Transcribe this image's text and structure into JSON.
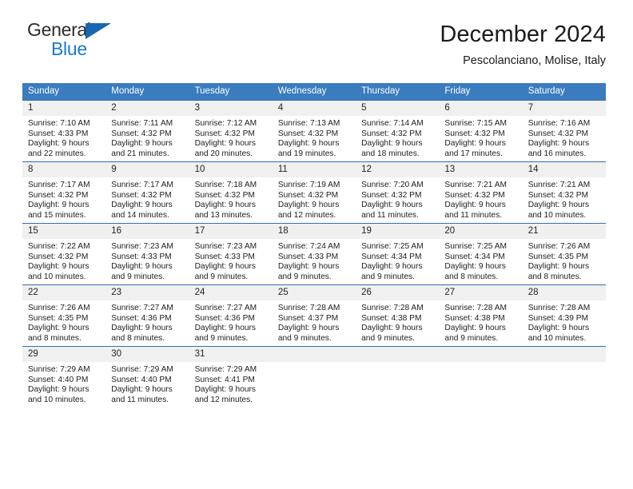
{
  "brand": {
    "word1": "General",
    "word2": "Blue",
    "triangle_color": "#1668b3",
    "blue_color": "#1b79c9"
  },
  "header": {
    "title": "December 2024",
    "subtitle": "Pescolanciano, Molise, Italy"
  },
  "theme": {
    "header_bg": "#3a7cbe",
    "header_text": "#ffffff",
    "row_divider": "#2f6fb0",
    "daynum_bg": "#f0f0f0"
  },
  "calendar": {
    "weekdays": [
      "Sunday",
      "Monday",
      "Tuesday",
      "Wednesday",
      "Thursday",
      "Friday",
      "Saturday"
    ],
    "weeks": [
      [
        {
          "day": "1",
          "sunrise": "Sunrise: 7:10 AM",
          "sunset": "Sunset: 4:33 PM",
          "daylight1": "Daylight: 9 hours",
          "daylight2": "and 22 minutes."
        },
        {
          "day": "2",
          "sunrise": "Sunrise: 7:11 AM",
          "sunset": "Sunset: 4:32 PM",
          "daylight1": "Daylight: 9 hours",
          "daylight2": "and 21 minutes."
        },
        {
          "day": "3",
          "sunrise": "Sunrise: 7:12 AM",
          "sunset": "Sunset: 4:32 PM",
          "daylight1": "Daylight: 9 hours",
          "daylight2": "and 20 minutes."
        },
        {
          "day": "4",
          "sunrise": "Sunrise: 7:13 AM",
          "sunset": "Sunset: 4:32 PM",
          "daylight1": "Daylight: 9 hours",
          "daylight2": "and 19 minutes."
        },
        {
          "day": "5",
          "sunrise": "Sunrise: 7:14 AM",
          "sunset": "Sunset: 4:32 PM",
          "daylight1": "Daylight: 9 hours",
          "daylight2": "and 18 minutes."
        },
        {
          "day": "6",
          "sunrise": "Sunrise: 7:15 AM",
          "sunset": "Sunset: 4:32 PM",
          "daylight1": "Daylight: 9 hours",
          "daylight2": "and 17 minutes."
        },
        {
          "day": "7",
          "sunrise": "Sunrise: 7:16 AM",
          "sunset": "Sunset: 4:32 PM",
          "daylight1": "Daylight: 9 hours",
          "daylight2": "and 16 minutes."
        }
      ],
      [
        {
          "day": "8",
          "sunrise": "Sunrise: 7:17 AM",
          "sunset": "Sunset: 4:32 PM",
          "daylight1": "Daylight: 9 hours",
          "daylight2": "and 15 minutes."
        },
        {
          "day": "9",
          "sunrise": "Sunrise: 7:17 AM",
          "sunset": "Sunset: 4:32 PM",
          "daylight1": "Daylight: 9 hours",
          "daylight2": "and 14 minutes."
        },
        {
          "day": "10",
          "sunrise": "Sunrise: 7:18 AM",
          "sunset": "Sunset: 4:32 PM",
          "daylight1": "Daylight: 9 hours",
          "daylight2": "and 13 minutes."
        },
        {
          "day": "11",
          "sunrise": "Sunrise: 7:19 AM",
          "sunset": "Sunset: 4:32 PM",
          "daylight1": "Daylight: 9 hours",
          "daylight2": "and 12 minutes."
        },
        {
          "day": "12",
          "sunrise": "Sunrise: 7:20 AM",
          "sunset": "Sunset: 4:32 PM",
          "daylight1": "Daylight: 9 hours",
          "daylight2": "and 11 minutes."
        },
        {
          "day": "13",
          "sunrise": "Sunrise: 7:21 AM",
          "sunset": "Sunset: 4:32 PM",
          "daylight1": "Daylight: 9 hours",
          "daylight2": "and 11 minutes."
        },
        {
          "day": "14",
          "sunrise": "Sunrise: 7:21 AM",
          "sunset": "Sunset: 4:32 PM",
          "daylight1": "Daylight: 9 hours",
          "daylight2": "and 10 minutes."
        }
      ],
      [
        {
          "day": "15",
          "sunrise": "Sunrise: 7:22 AM",
          "sunset": "Sunset: 4:32 PM",
          "daylight1": "Daylight: 9 hours",
          "daylight2": "and 10 minutes."
        },
        {
          "day": "16",
          "sunrise": "Sunrise: 7:23 AM",
          "sunset": "Sunset: 4:33 PM",
          "daylight1": "Daylight: 9 hours",
          "daylight2": "and 9 minutes."
        },
        {
          "day": "17",
          "sunrise": "Sunrise: 7:23 AM",
          "sunset": "Sunset: 4:33 PM",
          "daylight1": "Daylight: 9 hours",
          "daylight2": "and 9 minutes."
        },
        {
          "day": "18",
          "sunrise": "Sunrise: 7:24 AM",
          "sunset": "Sunset: 4:33 PM",
          "daylight1": "Daylight: 9 hours",
          "daylight2": "and 9 minutes."
        },
        {
          "day": "19",
          "sunrise": "Sunrise: 7:25 AM",
          "sunset": "Sunset: 4:34 PM",
          "daylight1": "Daylight: 9 hours",
          "daylight2": "and 9 minutes."
        },
        {
          "day": "20",
          "sunrise": "Sunrise: 7:25 AM",
          "sunset": "Sunset: 4:34 PM",
          "daylight1": "Daylight: 9 hours",
          "daylight2": "and 8 minutes."
        },
        {
          "day": "21",
          "sunrise": "Sunrise: 7:26 AM",
          "sunset": "Sunset: 4:35 PM",
          "daylight1": "Daylight: 9 hours",
          "daylight2": "and 8 minutes."
        }
      ],
      [
        {
          "day": "22",
          "sunrise": "Sunrise: 7:26 AM",
          "sunset": "Sunset: 4:35 PM",
          "daylight1": "Daylight: 9 hours",
          "daylight2": "and 8 minutes."
        },
        {
          "day": "23",
          "sunrise": "Sunrise: 7:27 AM",
          "sunset": "Sunset: 4:36 PM",
          "daylight1": "Daylight: 9 hours",
          "daylight2": "and 8 minutes."
        },
        {
          "day": "24",
          "sunrise": "Sunrise: 7:27 AM",
          "sunset": "Sunset: 4:36 PM",
          "daylight1": "Daylight: 9 hours",
          "daylight2": "and 9 minutes."
        },
        {
          "day": "25",
          "sunrise": "Sunrise: 7:28 AM",
          "sunset": "Sunset: 4:37 PM",
          "daylight1": "Daylight: 9 hours",
          "daylight2": "and 9 minutes."
        },
        {
          "day": "26",
          "sunrise": "Sunrise: 7:28 AM",
          "sunset": "Sunset: 4:38 PM",
          "daylight1": "Daylight: 9 hours",
          "daylight2": "and 9 minutes."
        },
        {
          "day": "27",
          "sunrise": "Sunrise: 7:28 AM",
          "sunset": "Sunset: 4:38 PM",
          "daylight1": "Daylight: 9 hours",
          "daylight2": "and 9 minutes."
        },
        {
          "day": "28",
          "sunrise": "Sunrise: 7:28 AM",
          "sunset": "Sunset: 4:39 PM",
          "daylight1": "Daylight: 9 hours",
          "daylight2": "and 10 minutes."
        }
      ],
      [
        {
          "day": "29",
          "sunrise": "Sunrise: 7:29 AM",
          "sunset": "Sunset: 4:40 PM",
          "daylight1": "Daylight: 9 hours",
          "daylight2": "and 10 minutes."
        },
        {
          "day": "30",
          "sunrise": "Sunrise: 7:29 AM",
          "sunset": "Sunset: 4:40 PM",
          "daylight1": "Daylight: 9 hours",
          "daylight2": "and 11 minutes."
        },
        {
          "day": "31",
          "sunrise": "Sunrise: 7:29 AM",
          "sunset": "Sunset: 4:41 PM",
          "daylight1": "Daylight: 9 hours",
          "daylight2": "and 12 minutes."
        },
        {
          "day": "",
          "sunrise": "",
          "sunset": "",
          "daylight1": "",
          "daylight2": ""
        },
        {
          "day": "",
          "sunrise": "",
          "sunset": "",
          "daylight1": "",
          "daylight2": ""
        },
        {
          "day": "",
          "sunrise": "",
          "sunset": "",
          "daylight1": "",
          "daylight2": ""
        },
        {
          "day": "",
          "sunrise": "",
          "sunset": "",
          "daylight1": "",
          "daylight2": ""
        }
      ]
    ]
  }
}
